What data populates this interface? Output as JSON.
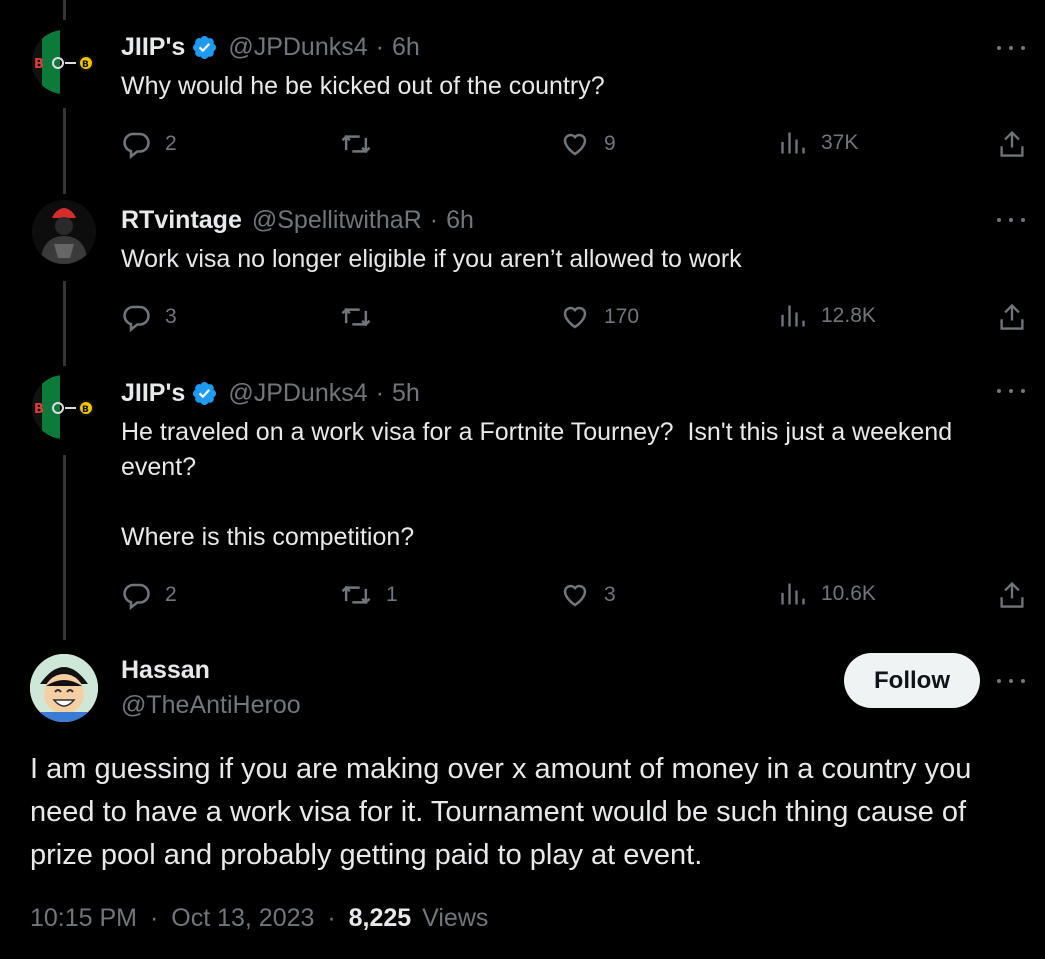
{
  "replies": [
    {
      "name": "JIIP's",
      "handle": "@JPDunks4",
      "time": "6h",
      "verified": true,
      "text": "Why would he be kicked out of the country?",
      "avatar_text": "BO-◦B",
      "stats": {
        "replies": "2",
        "reposts": "",
        "likes": "9",
        "views": "37K"
      }
    },
    {
      "name": "RTvintage",
      "handle": "@SpellitwithaR",
      "time": "6h",
      "verified": false,
      "text": "Work visa no longer eligible if you aren’t allowed to work",
      "stats": {
        "replies": "3",
        "reposts": "",
        "likes": "170",
        "views": "12.8K"
      }
    },
    {
      "name": "JIIP's",
      "handle": "@JPDunks4",
      "time": "5h",
      "verified": true,
      "text_line1": "He traveled on a work visa for a Fortnite Tourney?  Isn't this just a weekend",
      "text_line2": "event?",
      "text_line3": "Where is this competition?",
      "avatar_text": "BO-◦B",
      "stats": {
        "replies": "2",
        "reposts": "1",
        "likes": "3",
        "views": "10.6K"
      }
    }
  ],
  "main_post": {
    "name": "Hassan",
    "handle": "@TheAntiHeroo",
    "follow_label": "Follow",
    "text": "I am guessing if you are making over x amount of money in a country you need to have a work visa for it. Tournament would be such thing cause of prize pool and probably getting paid to play at event.",
    "time": "10:15 PM",
    "date": "Oct 13, 2023",
    "views_count": "8,225",
    "views_label": "Views"
  },
  "separator": "·",
  "colors": {
    "background": "#000000",
    "text": "#e7e9ea",
    "muted": "#71767b",
    "verified": "#1d9bf0"
  }
}
